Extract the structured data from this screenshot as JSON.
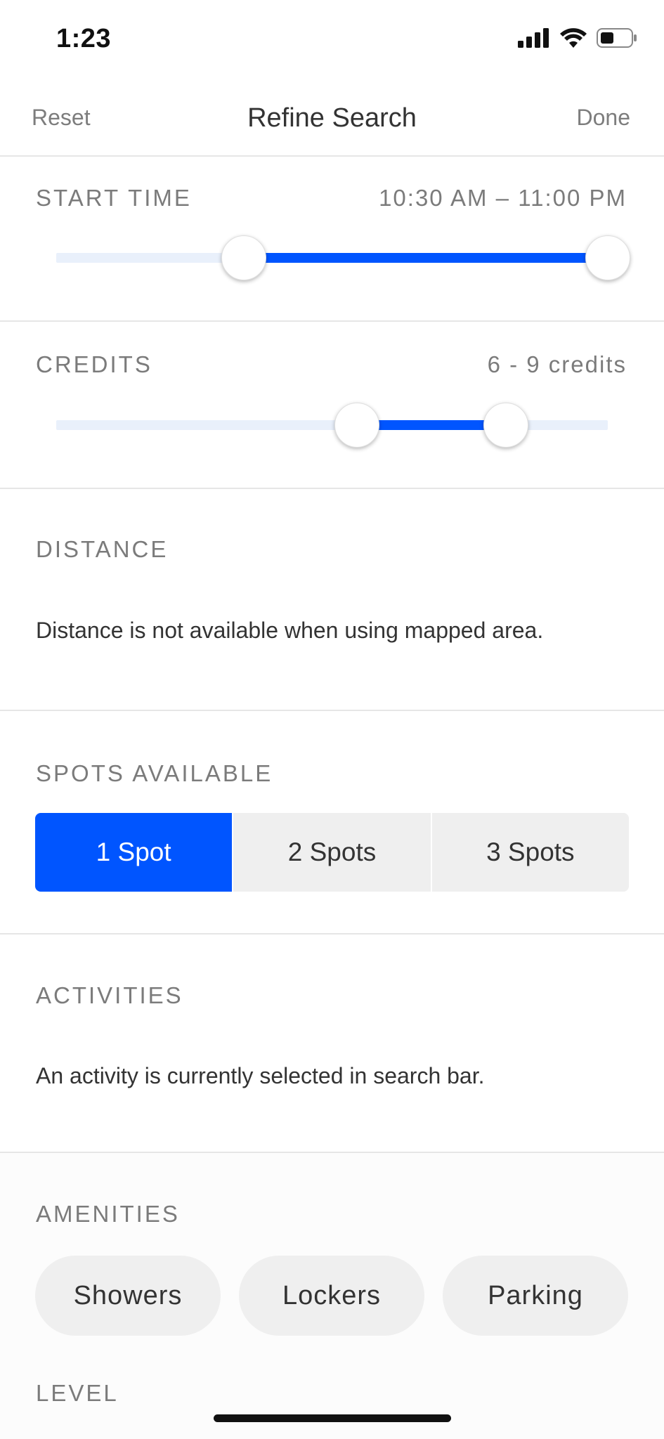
{
  "status_bar": {
    "time": "1:23"
  },
  "nav": {
    "reset": "Reset",
    "title": "Refine Search",
    "done": "Done"
  },
  "start_time": {
    "label": "START TIME",
    "value": "10:30 AM – 11:00 PM",
    "range_low_fraction": 0.34,
    "range_high_fraction": 1.0,
    "fill_color": "#0055ff"
  },
  "credits": {
    "label": "CREDITS",
    "value": "6 - 9 credits",
    "range_low_fraction": 0.545,
    "range_high_fraction": 0.815
  },
  "distance": {
    "label": "DISTANCE",
    "text": "Distance is not available when using mapped area."
  },
  "spots": {
    "label": "SPOTS AVAILABLE",
    "options": [
      "1 Spot",
      "2 Spots",
      "3 Spots"
    ],
    "selected": "1 Spot"
  },
  "activities": {
    "label": "ACTIVITIES",
    "text": "An activity is currently selected in search bar."
  },
  "amenities": {
    "label": "AMENITIES",
    "options": [
      "Showers",
      "Lockers",
      "Parking"
    ]
  },
  "level": {
    "label": "LEVEL"
  },
  "icons": [
    "signal-icon",
    "wifi-icon",
    "battery-icon"
  ]
}
